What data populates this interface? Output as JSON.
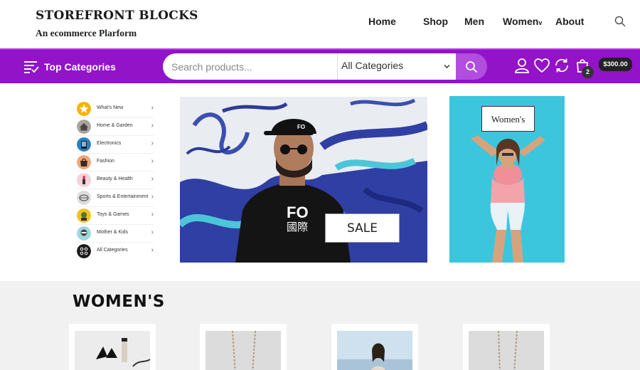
{
  "brand": {
    "title": "STOREFRONT BLOCKS",
    "subtitle": "An ecommerce Plarform"
  },
  "nav": {
    "home": "Home",
    "shop": "Shop",
    "men": "Men",
    "women": "Women",
    "women_chevron": "v",
    "about": "About"
  },
  "topbar": {
    "top_categories_label": "Top Categories",
    "search_placeholder": "Search products...",
    "category_select": "All Categories",
    "cart_count": "2",
    "cart_total": "$300.00"
  },
  "categories": [
    {
      "label": "What's New"
    },
    {
      "label": "Home & Garden"
    },
    {
      "label": "Electronics"
    },
    {
      "label": "Fashion"
    },
    {
      "label": "Beauty & Health"
    },
    {
      "label": "Sports & Entertainment"
    },
    {
      "label": "Toys & Games"
    },
    {
      "label": "Mother & Kids"
    },
    {
      "label": "All Categories"
    }
  ],
  "hero": {
    "sale_label": "SALE",
    "shirt_text": "FO",
    "shirt_kanji": "國際",
    "cap_text": "FO"
  },
  "side_banner": {
    "label": "Women's"
  },
  "section": {
    "title": "WOMEN'S"
  },
  "colors": {
    "accent": "#9313c9",
    "search_button": "#b14ee0",
    "banner_bg": "#3bc6de"
  },
  "icons": {
    "top_categories": "list-icon",
    "search_button": "search-icon",
    "account": "user-icon",
    "wishlist": "heart-icon",
    "compare": "refresh-icon",
    "cart": "cart-icon",
    "header_search": "search-icon"
  }
}
